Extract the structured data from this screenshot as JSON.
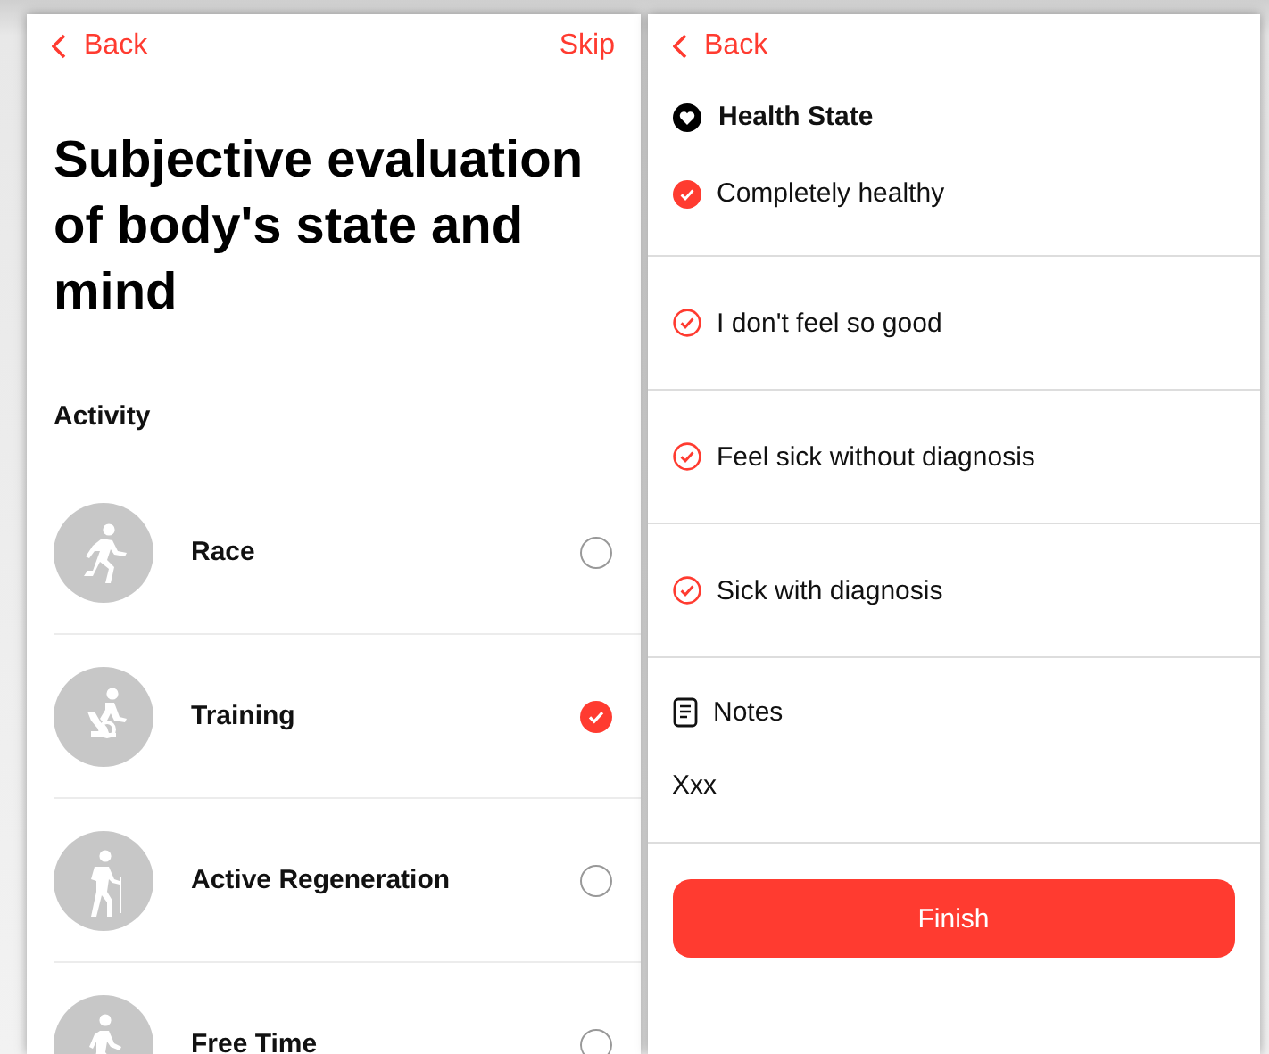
{
  "activity_screen": {
    "back": "Back",
    "skip": "Skip",
    "title": "Subjective evaluation of body's state and mind",
    "section": "Activity",
    "activities": [
      {
        "label": "Race",
        "kind": "run",
        "selected": false
      },
      {
        "label": "Training",
        "kind": "bike",
        "selected": true
      },
      {
        "label": "Active Regeneration",
        "kind": "hike",
        "selected": false
      },
      {
        "label": "Free Time",
        "kind": "walk",
        "selected": false
      }
    ]
  },
  "health_screen": {
    "back": "Back",
    "title": "Health State",
    "options": [
      {
        "label": "Completely healthy",
        "selected": true
      },
      {
        "label": "I don't feel so good",
        "selected": false
      },
      {
        "label": "Feel sick without diagnosis",
        "selected": false
      },
      {
        "label": "Sick with diagnosis",
        "selected": false
      }
    ],
    "notes": {
      "label": "Notes",
      "value": "Xxx"
    },
    "finish": "Finish"
  }
}
